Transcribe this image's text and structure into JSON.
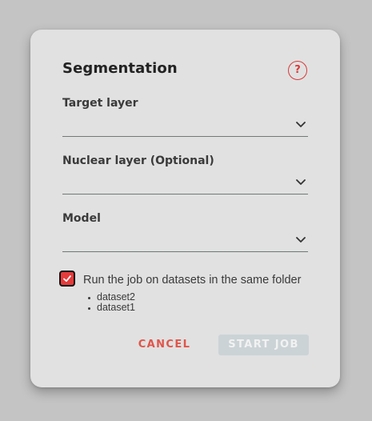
{
  "dialog": {
    "title": "Segmentation",
    "help_icon": "question-circle-icon",
    "help_glyph": "?",
    "accent_color": "#e53b3b"
  },
  "fields": [
    {
      "label": "Target layer",
      "value": ""
    },
    {
      "label": "Nuclear layer (Optional)",
      "value": ""
    },
    {
      "label": "Model",
      "value": ""
    }
  ],
  "same_folder": {
    "checked": true,
    "label": "Run the job on datasets in the same folder",
    "datasets": [
      "dataset2",
      "dataset1"
    ]
  },
  "actions": {
    "cancel_label": "CANCEL",
    "start_label": "START JOB",
    "start_disabled": true
  }
}
